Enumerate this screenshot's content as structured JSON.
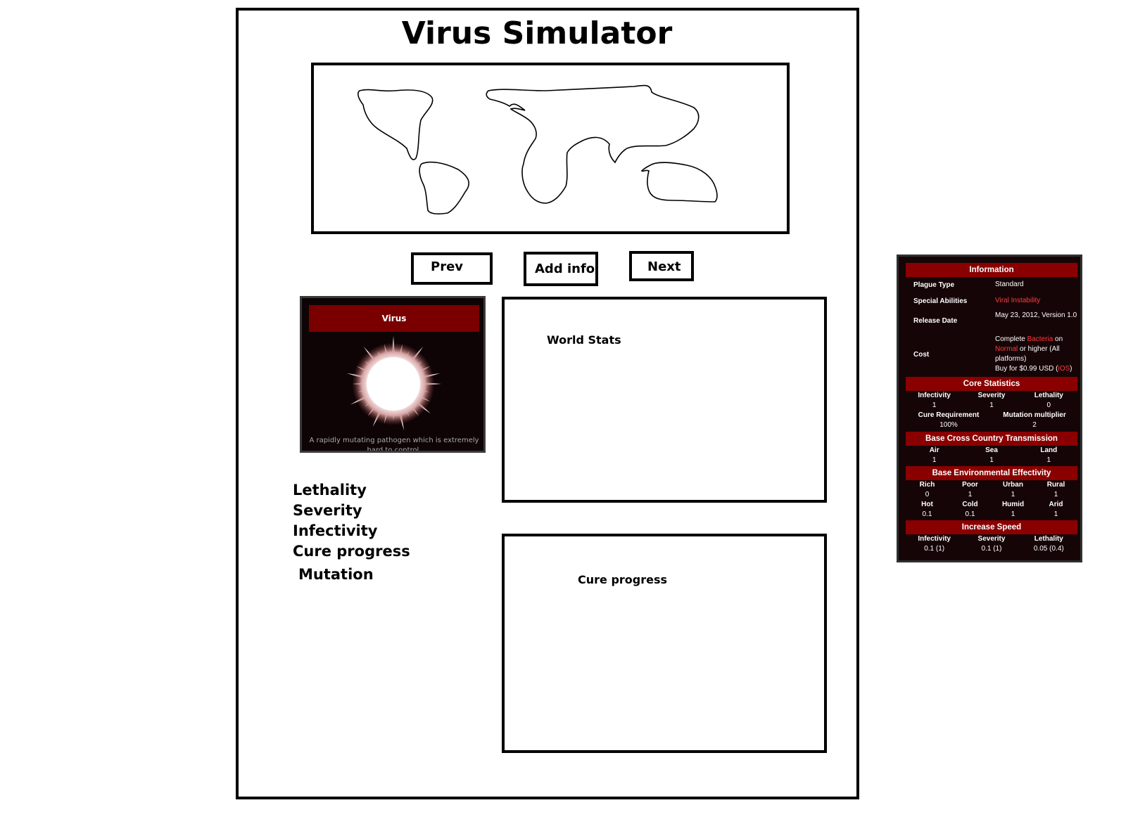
{
  "page_title": "Virus Simulator",
  "map": {
    "icon": "world-map-outline"
  },
  "buttons": {
    "prev": "Prev",
    "add_info": "Add info",
    "next": "Next"
  },
  "virus_card": {
    "header": "Virus",
    "description": "A rapidly mutating pathogen which is extremely hard to control.",
    "icon": "virus-burst-icon"
  },
  "stat_labels": [
    "Lethality",
    "Severity",
    "Infectivity",
    "Cure progress",
    "Mutation"
  ],
  "world_stats": {
    "title": "World Stats"
  },
  "cure_panel": {
    "title": "Cure progress"
  },
  "info_card": {
    "information_title": "Information",
    "plague_type_label": "Plague Type",
    "plague_type_value": "Standard",
    "special_abilities_label": "Special Abilities",
    "special_abilities_value": "Viral Instability",
    "release_date_label": "Release Date",
    "release_date_value": "May 23, 2012, Version 1.0",
    "cost_label": "Cost",
    "cost_part1": "Complete ",
    "cost_bacteria": "Bacteria",
    "cost_part2": " on ",
    "cost_normal": "Normal",
    "cost_part3": " or higher (All platforms)",
    "cost_part4": "Buy for $0.99 USD (",
    "cost_ios": "iOS",
    "cost_part5": ")",
    "core_title": "Core Statistics",
    "core_headers": [
      "Infectivity",
      "Severity",
      "Lethality"
    ],
    "core_values": [
      "1",
      "1",
      "0"
    ],
    "core_headers2": [
      "Cure Requirement",
      "Mutation multiplier"
    ],
    "core_values2": [
      "100%",
      "2"
    ],
    "transmission_title": "Base Cross Country Transmission",
    "transmission_headers": [
      "Air",
      "Sea",
      "Land"
    ],
    "transmission_values": [
      "1",
      "1",
      "1"
    ],
    "env_title": "Base Environmental Effectivity",
    "env_headers1": [
      "Rich",
      "Poor",
      "Urban",
      "Rural"
    ],
    "env_values1": [
      "0",
      "1",
      "1",
      "1"
    ],
    "env_headers2": [
      "Hot",
      "Cold",
      "Humid",
      "Arid"
    ],
    "env_values2": [
      "0.1",
      "0.1",
      "1",
      "1"
    ],
    "increase_title": "Increase Speed",
    "increase_headers": [
      "Infectivity",
      "Severity",
      "Lethality"
    ],
    "increase_values": [
      "0.1 (1)",
      "0.1 (1)",
      "0.05 (0.4)"
    ]
  },
  "colors": {
    "header_red": "#7a0000",
    "bar_red": "#8a0000",
    "link_red": "#ff3c3c",
    "card_bg": "#160507"
  }
}
